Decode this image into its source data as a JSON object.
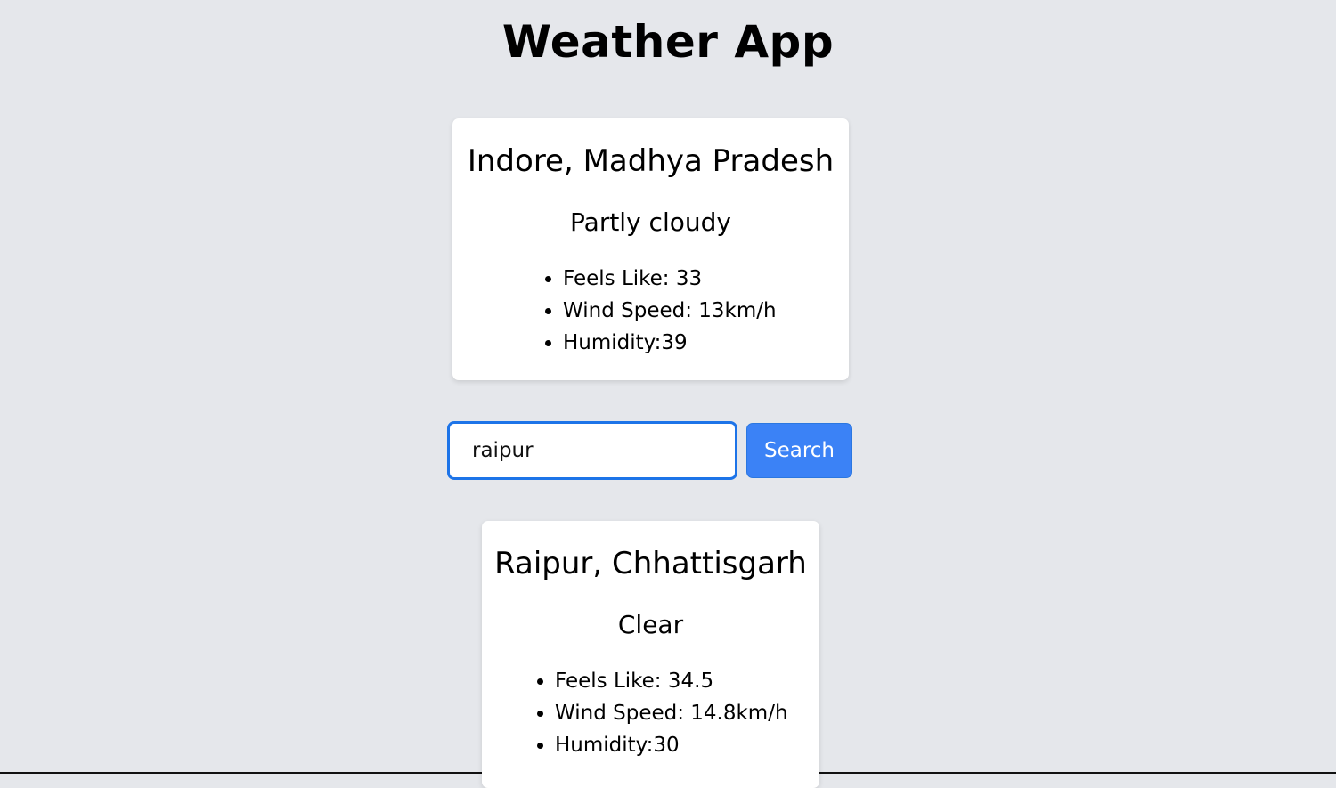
{
  "app": {
    "title": "Weather App"
  },
  "current_weather": {
    "location": "Indore, Madhya Pradesh",
    "condition": "Partly cloudy",
    "details": [
      "Feels Like: 33",
      "Wind Speed: 13km/h",
      "Humidity:39"
    ]
  },
  "search": {
    "value": "raipur",
    "button_label": "Search"
  },
  "search_result": {
    "location": "Raipur, Chhattisgarh",
    "condition": "Clear",
    "details": [
      "Feels Like: 34.5",
      "Wind Speed: 14.8km/h",
      "Humidity:30"
    ]
  },
  "colors": {
    "background": "#e5e7eb",
    "card": "#ffffff",
    "accent": "#3b82f6",
    "input_focus_border": "#1d74e8"
  }
}
